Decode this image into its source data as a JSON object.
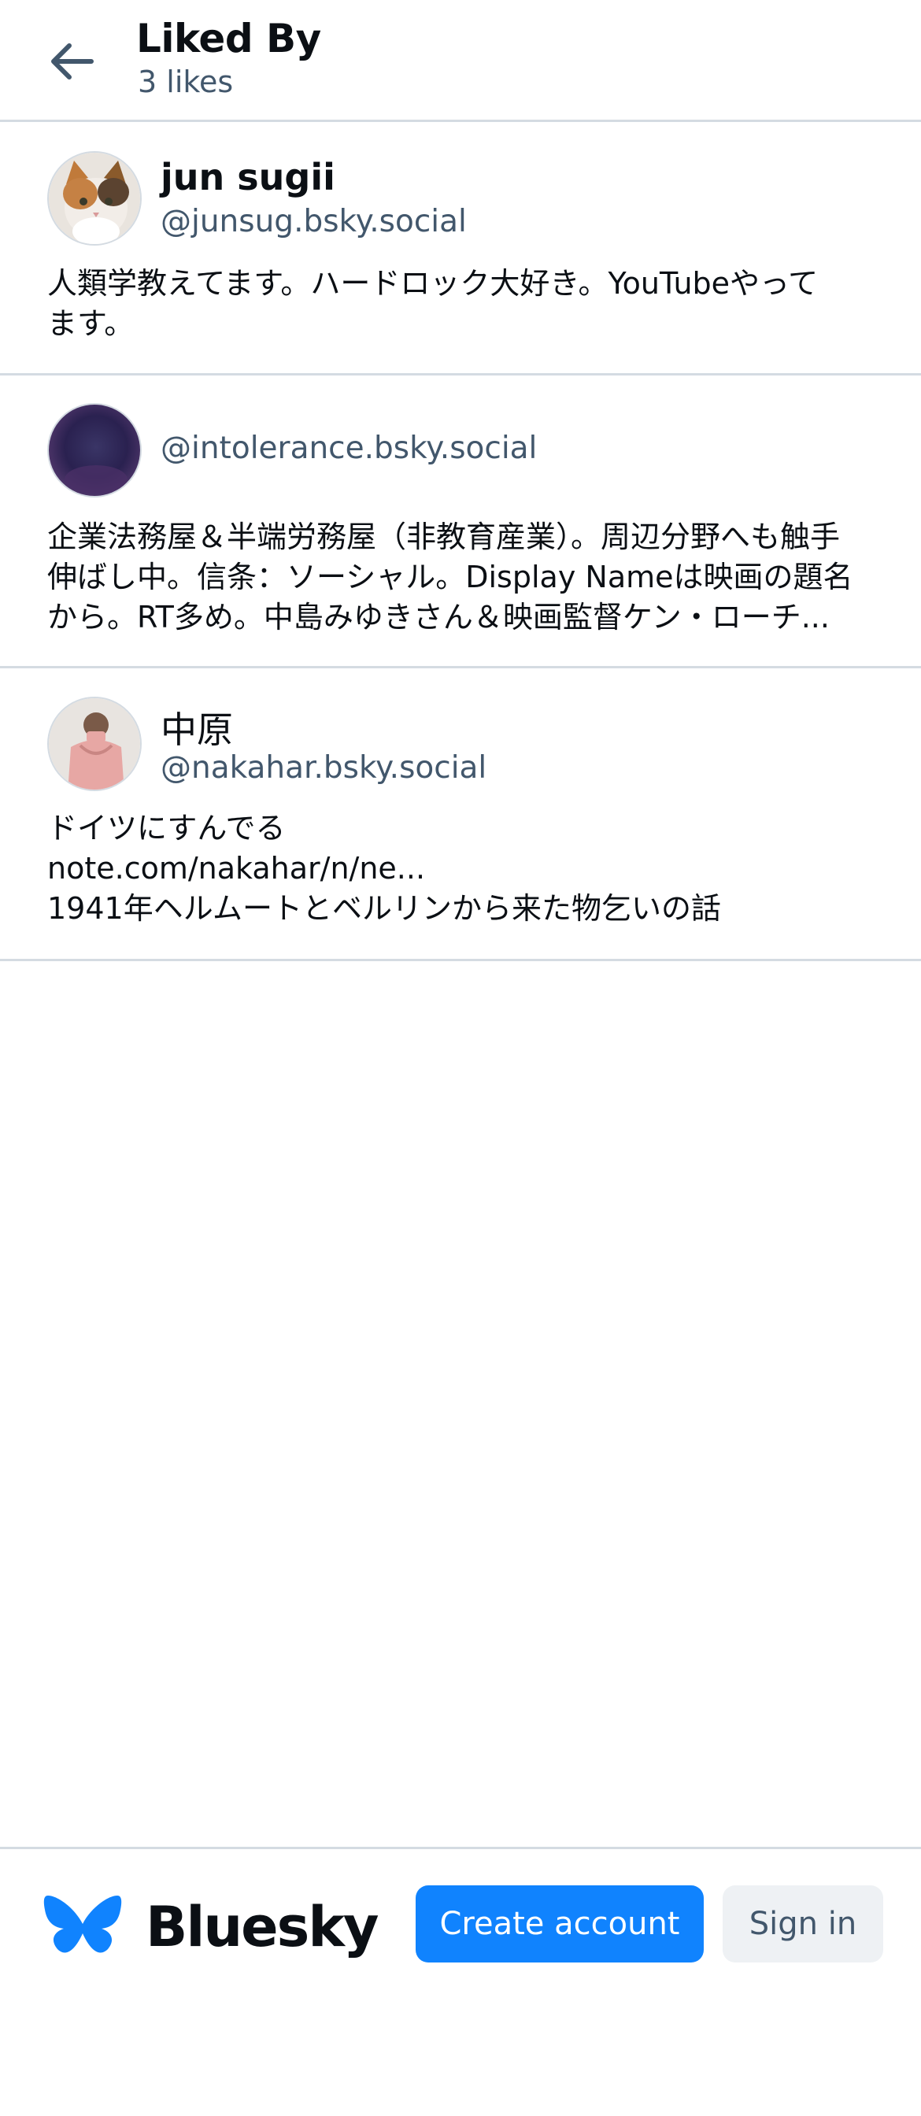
{
  "header": {
    "title": "Liked By",
    "subtitle": "3 likes",
    "back_icon": "arrow-left-icon"
  },
  "users": [
    {
      "display_name": "jun sugii",
      "handle": "@junsug.bsky.social",
      "bio_lines": [
        "人類学教えてます。ハードロック大好き。YouTubeやって",
        "ます。"
      ],
      "avatar": "cat-photo"
    },
    {
      "display_name": "",
      "handle": "@intolerance.bsky.social",
      "bio_lines": [
        "企業法務屋＆半端労務屋（非教育産業）。周辺分野へも触手",
        "伸ばし中。信条：ソーシャル。Display Nameは映画の題名",
        "から。RT多め。中島みゆきさん＆映画監督ケン・ローチ..."
      ],
      "avatar": "dark-blurred-photo"
    },
    {
      "display_name": "中原",
      "handle": "@nakahar.bsky.social",
      "bio_lines": [
        "ドイツにすんでる",
        "note.com/nakahar/n/ne...",
        "1941年ヘルムートとベルリンから来た物乞いの話"
      ],
      "avatar": "person-pink-shirt-photo"
    }
  ],
  "footer": {
    "brand": "Bluesky",
    "logo_icon": "butterfly-logo-icon",
    "create_account_label": "Create account",
    "sign_in_label": "Sign in",
    "accent_color": "#1083fe"
  }
}
